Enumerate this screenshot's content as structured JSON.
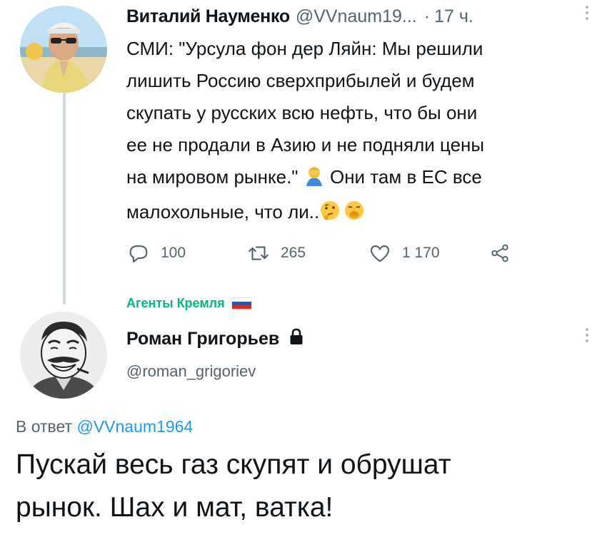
{
  "tweet1": {
    "author_name": "Виталий Науменко",
    "handle": "@VVnaum19...",
    "separator": "·",
    "time": "17 ч.",
    "lines": [
      "СМИ: \"Урсула фон дер Ляйн: Мы решили",
      "лишить Россию сверхприбылей и будем",
      "скупать у русских всю нефть, что бы они",
      "ее не продали в Азию и не подняли цены"
    ],
    "line5_before": "на мировом рынке.\" ",
    "line5_after": " Они там в ЕС все",
    "line6": "малохольные, что ли..",
    "emojis": [
      "man-facepalming-emoji",
      "thinking-face-emoji",
      "yawning-face-emoji"
    ],
    "actions": {
      "reply_count": "100",
      "retweet_count": "265",
      "like_count": "1 170"
    }
  },
  "community": {
    "label": "Агенты Кремля",
    "flag": "russia-flag"
  },
  "tweet2": {
    "author_name": "Роман Григорьев",
    "handle": "@roman_grigoriev",
    "reply_prefix": "В ответ ",
    "reply_mention": "@VVnaum1964",
    "text_lines": [
      "Пускай весь газ скупят и обрушат",
      "рынок. Шах и мат, ватка!"
    ]
  },
  "colors": {
    "text": "#0f1419",
    "secondary": "#536471",
    "link": "#1d9bf0",
    "community": "#00ba7c",
    "thread_line": "#cfd9de"
  }
}
